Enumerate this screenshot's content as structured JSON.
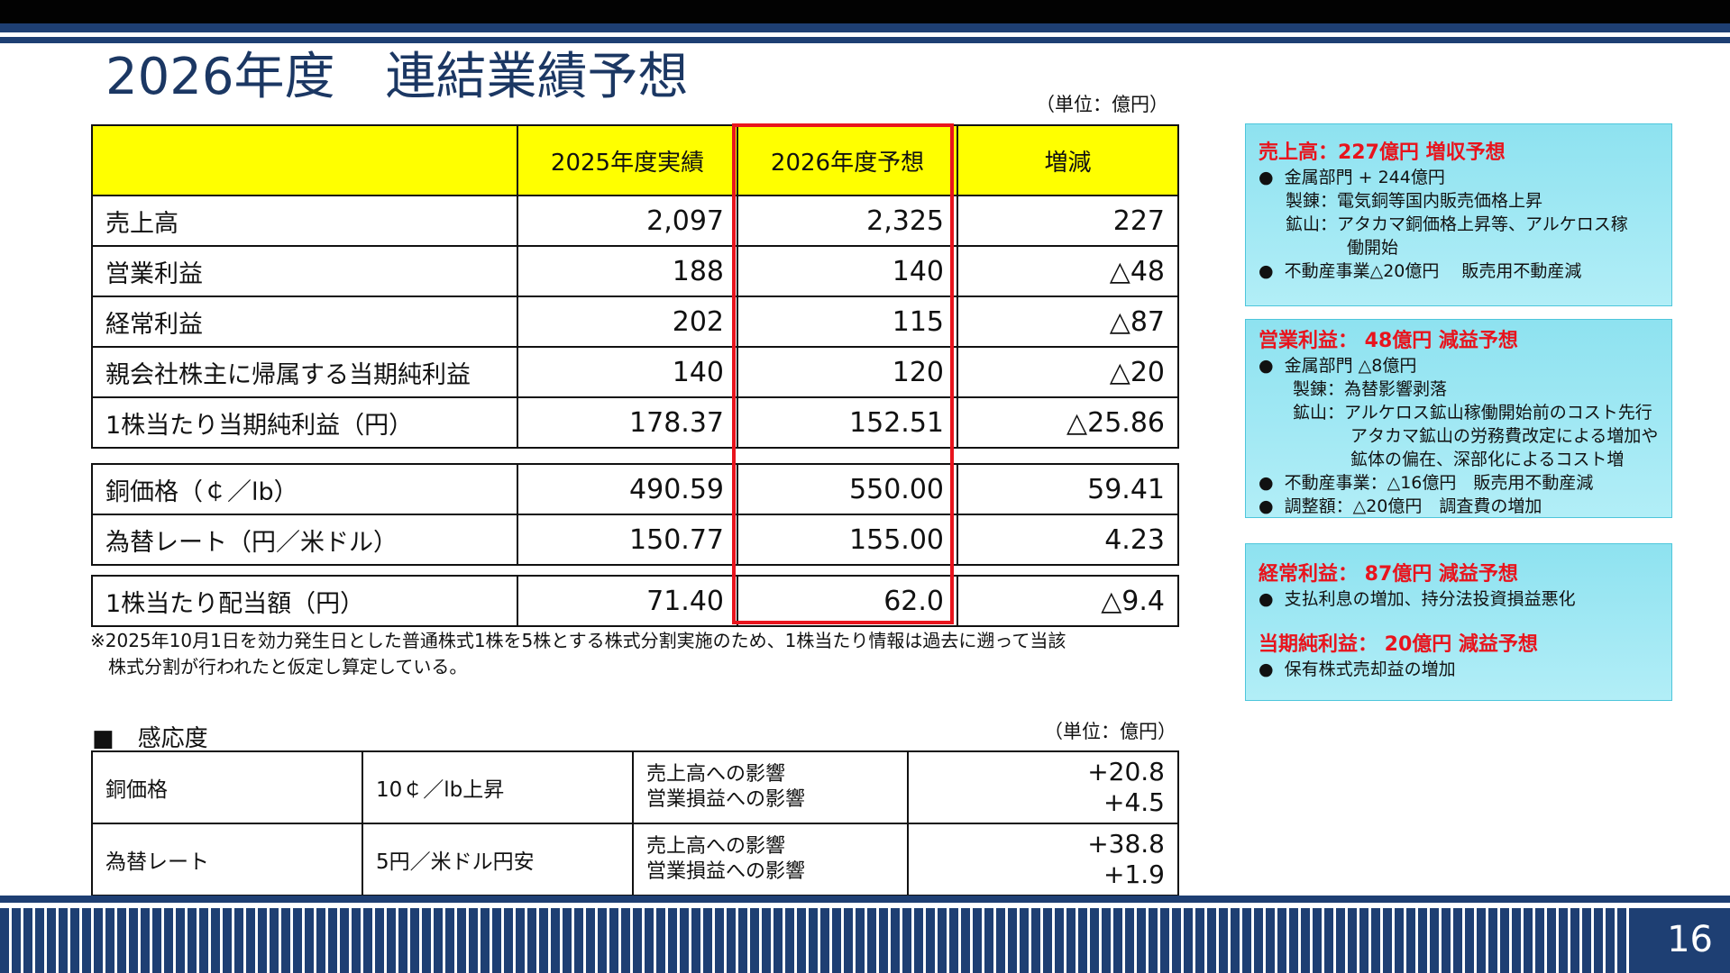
{
  "title": "2026年度　連結業績予想",
  "unit_main": "（単位：億円）",
  "main_table": {
    "headers": [
      "",
      "2025年度実績",
      "2026年度予想",
      "増減"
    ],
    "rows": [
      {
        "label": "売上高",
        "actual_2025": "2,097",
        "forecast_2026": "2,325",
        "change": "227"
      },
      {
        "label": "営業利益",
        "actual_2025": "188",
        "forecast_2026": "140",
        "change": "△48"
      },
      {
        "label": "経常利益",
        "actual_2025": "202",
        "forecast_2026": "115",
        "change": "△87"
      },
      {
        "label": "親会社株主に帰属する当期純利益",
        "actual_2025": "140",
        "forecast_2026": "120",
        "change": "△20"
      },
      {
        "label": "1株当たり当期純利益（円）",
        "actual_2025": "178.37",
        "forecast_2026": "152.51",
        "change": "△25.86"
      },
      {
        "label": "銅価格（￠／lb）",
        "actual_2025": "490.59",
        "forecast_2026": "550.00",
        "change": "59.41"
      },
      {
        "label": "為替レート（円／米ドル）",
        "actual_2025": "150.77",
        "forecast_2026": "155.00",
        "change": "4.23"
      },
      {
        "label": "1株当たり配当額（円）",
        "actual_2025": "71.40",
        "forecast_2026": "62.0",
        "change": "△9.4"
      }
    ]
  },
  "note_line1": "※2025年10月1日を効力発生日とした普通株式1株を5株とする株式分割実施のため、1株当たり情報は過去に遡って当該",
  "note_line2": "　株式分割が行われたと仮定し算定している。",
  "sensitivity": {
    "title": "■　感応度",
    "unit": "（単位：億円）",
    "rows": [
      {
        "item": "銅価格",
        "condition": "10￠／lb上昇",
        "impact1": "売上高への影響",
        "impact2": "営業損益への影響",
        "value1": "+20.8",
        "value2": "+4.5"
      },
      {
        "item": "為替レート",
        "condition": "5円／米ドル円安",
        "impact1": "売上高への影響",
        "impact2": "営業損益への影響",
        "value1": "+38.8",
        "value2": "+1.9"
      }
    ]
  },
  "panels": {
    "sales": {
      "heading": "売上高：227億円 増収予想",
      "l1": "金属部門 + 244億円",
      "l2": "製錬：電気銅等国内販売価格上昇",
      "l3": "鉱山：アタカマ銅価格上昇等、アルケロス稼",
      "l4": "働開始",
      "l5": "不動産事業△20億円　 販売用不動産減"
    },
    "operating": {
      "heading": "営業利益：  48億円 減益予想",
      "l1": "金属部門 △8億円",
      "l2": "製錬：為替影響剥落",
      "l3": "鉱山：アルケロス鉱山稼働開始前のコスト先行",
      "l4": "アタカマ鉱山の労務費改定による増加や",
      "l5": "鉱体の偏在、深部化によるコスト増",
      "l6": "不動産事業：△16億円　販売用不動産減",
      "l7": "調整額：△20億円　調査費の増加"
    },
    "ordinary": {
      "heading": "経常利益：  87億円 減益予想",
      "l1": "支払利息の増加、持分法投資損益悪化",
      "heading2": "当期純利益：  20億円 減益予想",
      "l2": "保有株式売却益の増加"
    }
  },
  "page_number": "16",
  "colors": {
    "navy": "#1e3f73",
    "header_yellow": "#ffff00",
    "highlight_red": "#e8141d",
    "panel_cyan": "#a6ecf6"
  }
}
